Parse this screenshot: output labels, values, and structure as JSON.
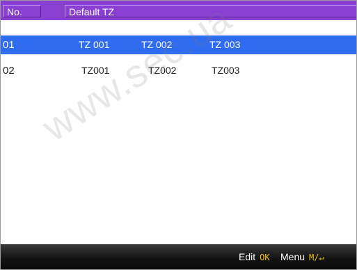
{
  "header": {
    "col_no": "No.",
    "col_tz": "Default  TZ"
  },
  "rows": [
    {
      "no": "01",
      "tz1": "TZ 001",
      "tz2": "TZ 002",
      "tz3": "TZ 003",
      "selected": true
    },
    {
      "no": "02",
      "tz1": "TZ001",
      "tz2": "TZ002",
      "tz3": "TZ003",
      "selected": false
    }
  ],
  "watermark": "www.sec.ua",
  "footer": {
    "edit_label": "Edit",
    "edit_key": "OK",
    "menu_label": "Menu",
    "menu_key": "M/↵"
  },
  "colors": {
    "header": "#8a3fd3",
    "selection": "#2f6cf0",
    "key_highlight": "#f2c400"
  }
}
